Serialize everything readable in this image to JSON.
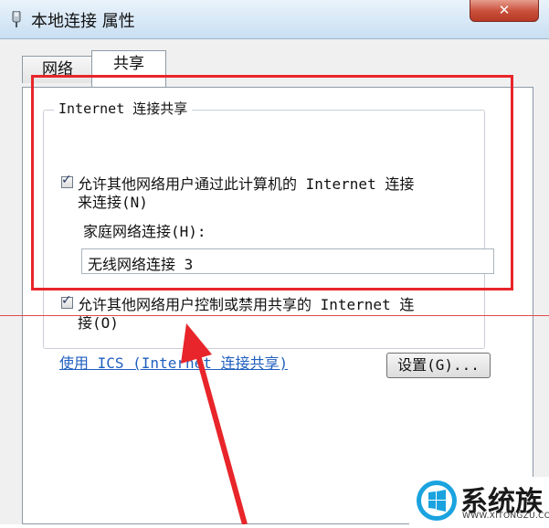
{
  "window": {
    "title": "本地连接 属性",
    "close_glyph": "✕"
  },
  "tabs": [
    {
      "label": "网络"
    },
    {
      "label": "共享"
    }
  ],
  "group": {
    "label": "Internet 连接共享"
  },
  "options": [
    {
      "line1": "允许其他网络用户通过此计算机的 Internet 连接",
      "line2": "来连接(N)",
      "checked": true
    },
    {
      "line1": "允许其他网络用户控制或禁用共享的 Internet 连",
      "line2": "接(O)",
      "checked": true
    }
  ],
  "home_connection": {
    "label": "家庭网络连接(H):",
    "value": "无线网络连接 3"
  },
  "ics_link": "使用 ICS (Internet 连接共享)",
  "settings_button": "设置(G)...",
  "watermark": {
    "brand": "系统族",
    "url": "WWW.XITONGZU.COM"
  },
  "colors": {
    "annotation_red": "#e8252a",
    "link_blue": "#1f5fbf"
  }
}
